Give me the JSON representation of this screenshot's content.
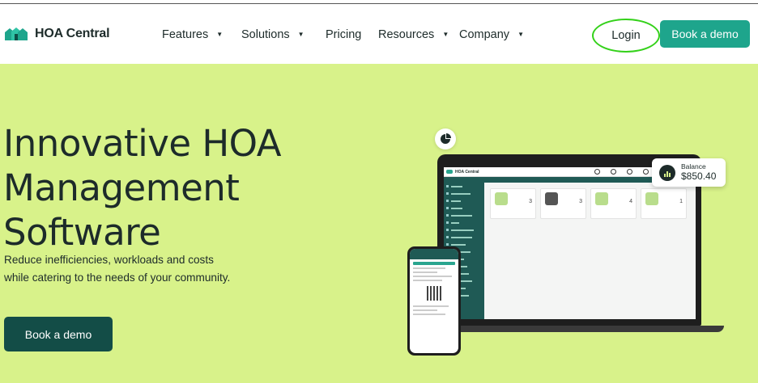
{
  "brand": {
    "name": "HOA Central",
    "logo_icon": "houses-logo-icon",
    "accent": "#1ea58c",
    "dark": "#134d47",
    "hero_bg": "#d8f28a"
  },
  "nav": {
    "items": [
      {
        "label": "Features",
        "has_dropdown": true
      },
      {
        "label": "Solutions",
        "has_dropdown": true
      },
      {
        "label": "Pricing",
        "has_dropdown": false
      },
      {
        "label": "Resources",
        "has_dropdown": true
      },
      {
        "label": "Company",
        "has_dropdown": true
      }
    ],
    "dropdown_glyph": "▼",
    "login_label": "Login",
    "login_highlight_color": "#34d11a",
    "cta_label": "Book a demo"
  },
  "hero": {
    "headline_lines": [
      "Innovative HOA",
      "Management",
      "Software"
    ],
    "subtext": "Reduce inefficiencies, workloads and costs while catering to the needs of your community.",
    "cta_label": "Book a demo"
  },
  "mockup": {
    "app_name": "HOA Central",
    "balance_label": "Balance",
    "balance_value": "$850.40",
    "card_counts": [
      "3",
      "3",
      "4",
      "1"
    ]
  }
}
